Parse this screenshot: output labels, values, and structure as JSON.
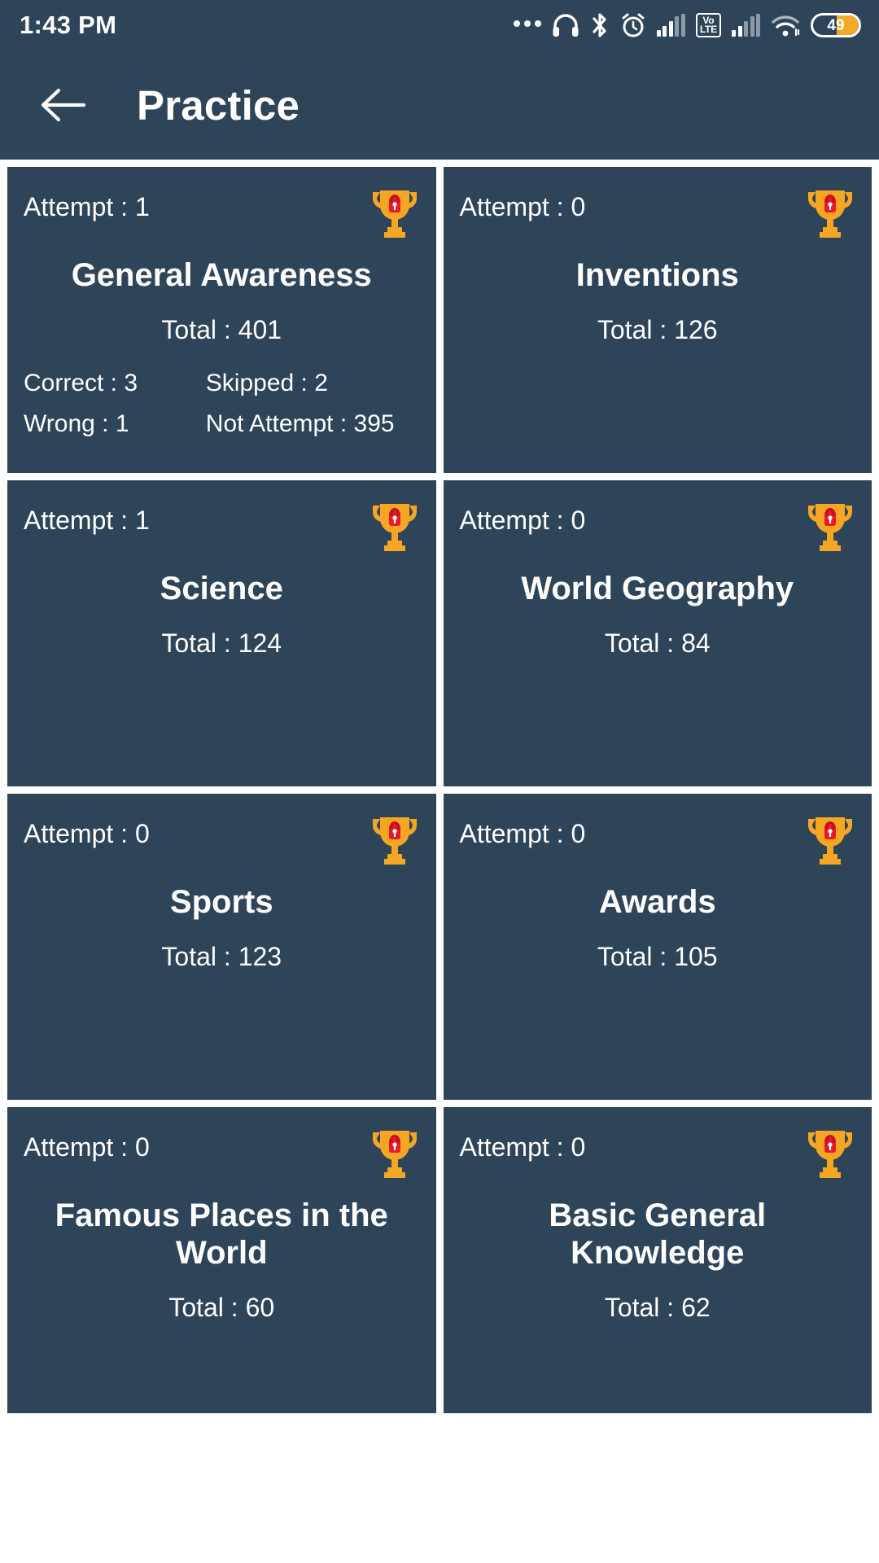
{
  "status_bar": {
    "time": "1:43 PM",
    "battery_level": "49",
    "battery_percent": 49,
    "volte_top": "Vo",
    "volte_bottom": "LTE",
    "icons": [
      "more-dots-icon",
      "headphones-icon",
      "bluetooth-icon",
      "alarm-icon",
      "signal-bars-icon",
      "volte-icon",
      "signal-bars-icon",
      "wifi-icon",
      "battery-icon"
    ]
  },
  "app_bar": {
    "back_icon": "arrow-left-icon",
    "title": "Practice"
  },
  "colors": {
    "background": "#ffffff",
    "card": "#2e4459",
    "status_bar": "#2e4459",
    "text": "#ffffff",
    "trophy_gold": "#f5a623",
    "trophy_gold_light": "#ffc54d",
    "lock_red": "#e8192c",
    "battery_fill": "#f0ab26"
  },
  "cards": [
    {
      "attempt_label": "Attempt : 1",
      "title": "General Awareness",
      "total_label": "Total : 401",
      "trophy_icon": "locked-trophy-icon",
      "stats": [
        {
          "left": "Correct : 3",
          "right": "Skipped : 2"
        },
        {
          "left": "Wrong : 1",
          "right": "Not Attempt : 395"
        }
      ]
    },
    {
      "attempt_label": "Attempt : 0",
      "title": "Inventions",
      "total_label": "Total : 126",
      "trophy_icon": "locked-trophy-icon",
      "stats": []
    },
    {
      "attempt_label": "Attempt : 1",
      "title": "Science",
      "total_label": "Total : 124",
      "trophy_icon": "locked-trophy-icon",
      "stats": []
    },
    {
      "attempt_label": "Attempt : 0",
      "title": "World Geography",
      "total_label": "Total : 84",
      "trophy_icon": "locked-trophy-icon",
      "stats": []
    },
    {
      "attempt_label": "Attempt : 0",
      "title": "Sports",
      "total_label": "Total : 123",
      "trophy_icon": "locked-trophy-icon",
      "stats": []
    },
    {
      "attempt_label": "Attempt : 0",
      "title": "Awards",
      "total_label": "Total : 105",
      "trophy_icon": "locked-trophy-icon",
      "stats": []
    },
    {
      "attempt_label": "Attempt : 0",
      "title": "Famous Places in the World",
      "total_label": "Total : 60",
      "trophy_icon": "locked-trophy-icon",
      "stats": []
    },
    {
      "attempt_label": "Attempt : 0",
      "title": "Basic General Knowledge",
      "total_label": "Total : 62",
      "trophy_icon": "locked-trophy-icon",
      "stats": []
    }
  ]
}
